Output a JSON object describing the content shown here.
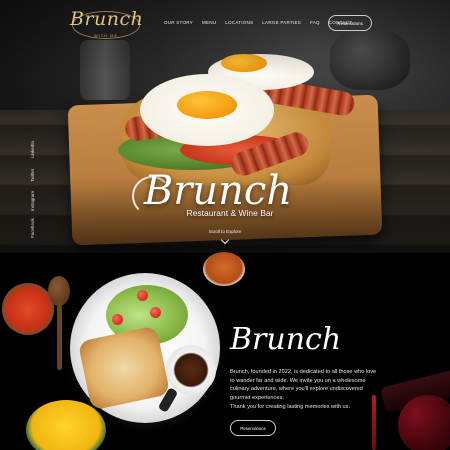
{
  "logo": {
    "main": "Brunch",
    "sub": "WITH ME"
  },
  "nav": {
    "items": [
      "OUR STORY",
      "MENU",
      "LOCATIONS",
      "LARGE PARTIES",
      "FAQ",
      "CONTACT"
    ],
    "reservations_label": "Reservations"
  },
  "social": [
    "Facebook",
    "Instagram",
    "Twitter",
    "LinkedIn"
  ],
  "hero": {
    "title": "Brunch",
    "subtitle": "Restaurant & Wine Bar",
    "scroll_label": "Scroll to Explore"
  },
  "about": {
    "title": "Brunch",
    "paragraph": "Brunch, founded in 2022, is dedicated to all those who love to wander far and wide. We invite you on a wholesome culinary adventure, where you'll explore undiscovered gourmet experiences.",
    "thanks": "Thank you for creating lasting memories with us.",
    "reservations_label": "Reservations"
  },
  "icons": {
    "scroll": "chevron-down-icon"
  },
  "colors": {
    "gold_logo": "#e3c27a",
    "background": "#000000",
    "text": "#ffffff"
  }
}
